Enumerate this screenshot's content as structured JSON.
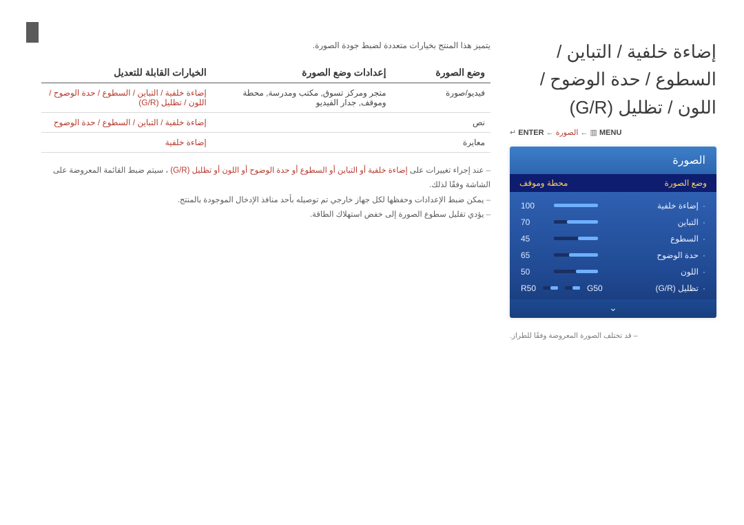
{
  "page_number": "",
  "title_line1": "إضاءة خلفية / التباين / السطوع / حدة الوضوح / اللون / تظليل (G/R)",
  "breadcrumb": {
    "menu_label": "MENU",
    "menu_icon": "▥",
    "arrow": "←",
    "picture": "الصورة",
    "enter_label": "ENTER",
    "enter_icon": "↵"
  },
  "osd": {
    "title": "الصورة",
    "sub_left": "وضع الصورة",
    "sub_right": "محطة وموقف",
    "rows": [
      {
        "label": "إضاءة خلفية",
        "value": "100",
        "pct": 100
      },
      {
        "label": "التباين",
        "value": "70",
        "pct": 70
      },
      {
        "label": "السطوع",
        "value": "45",
        "pct": 45
      },
      {
        "label": "حدة الوضوح",
        "value": "65",
        "pct": 65
      },
      {
        "label": "اللون",
        "value": "50",
        "pct": 50
      }
    ],
    "gr": {
      "label": "تظليل (G/R)",
      "g_label": "G50",
      "r_label": "R50",
      "g_pct": 50,
      "r_pct": 50
    }
  },
  "footnote": "قد تختلف الصورة المعروضة وفقًا للطراز.",
  "intro": "يتميز هذا المنتج بخيارات متعددة لضبط جودة الصورة.",
  "table": {
    "headers": [
      "وضع الصورة",
      "إعدادات وضع الصورة",
      "الخيارات القابلة للتعديل"
    ],
    "rows": [
      {
        "c1": "فيديو/صورة",
        "c2": "متجر ومركز تسوق, مكتب ومدرسة, محطة وموقف, جدار الفيديو",
        "c3": "إضاءة خلفية / التباين / السطوع / حدة الوضوح / اللون / تظليل (G/R)"
      },
      {
        "c1": "نص",
        "c2": "",
        "c3": "إضاءة خلفية / التباين / السطوع / حدة الوضوح"
      },
      {
        "c1": "معايرة",
        "c2": "",
        "c3": "إضاءة خلفية"
      }
    ]
  },
  "notes": {
    "n1_prefix": "عند إجراء تغييرات على ",
    "n1_items": "إضاءة خلفية أو التباين أو السطوع أو حدة الوضوح أو اللون أو تظليل (G/R)",
    "n1_suffix": "، سيتم ضبط القائمة المعروضة على الشاشة وفقًا لذلك.",
    "n2": "يمكن ضبط الإعدادات وحفظها لكل جهاز خارجي تم توصيله بأحد منافذ الإدخال الموجودة بالمنتج.",
    "n3": "يؤدي تقليل سطوع الصورة إلى خفض استهلاك الطاقة."
  }
}
